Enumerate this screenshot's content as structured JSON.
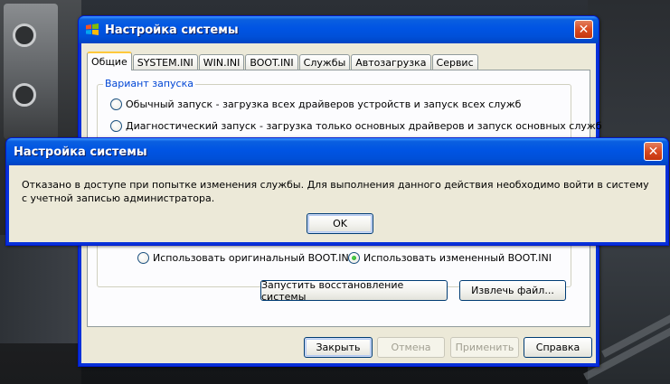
{
  "main_window": {
    "title": "Настройка системы",
    "tabs": [
      "Общие",
      "SYSTEM.INI",
      "WIN.INI",
      "BOOT.INI",
      "Службы",
      "Автозагрузка",
      "Сервис"
    ],
    "active_tab": "Общие",
    "startup_group": {
      "legend": "Вариант запуска",
      "options": [
        "Обычный запуск - загрузка всех драйверов устройств и запуск всех служб",
        "Диагностический запуск - загрузка только основных драйверов и запуск основных служб"
      ]
    },
    "boot_ini_options": {
      "original": "Использовать оригинальный  BOOT.INI",
      "modified": "Использовать измененный BOOT.INI",
      "selected": "modified"
    },
    "buttons": {
      "system_restore": "Запустить восстановление системы",
      "extract_file": "Извлечь файл..."
    },
    "footer": {
      "close": "Закрыть",
      "cancel": "Отмена",
      "apply": "Применить",
      "help": "Справка"
    }
  },
  "dialog": {
    "title": "Настройка системы",
    "message": "Отказано в доступе при попытке изменения службы. Для выполнения данного действия необходимо войти в систему с учетной записью администратора.",
    "ok": "OK"
  },
  "colors": {
    "titlebar": "#0054e3",
    "window_body": "#ece9d8",
    "close_button": "#d94a21",
    "group_legend": "#0046d5"
  }
}
